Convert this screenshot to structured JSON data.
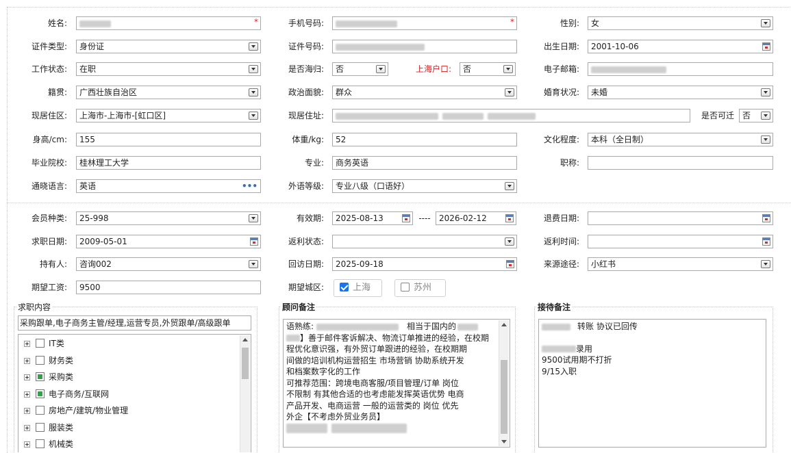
{
  "personal": {
    "name": {
      "label": "姓名:"
    },
    "mobile": {
      "label": "手机号码:"
    },
    "gender": {
      "label": "性别:",
      "value": "女"
    },
    "id_type": {
      "label": "证件类型:",
      "value": "身份证"
    },
    "id_no": {
      "label": "证件号码:"
    },
    "birth": {
      "label": "出生日期:",
      "value": "2001-10-06"
    },
    "work_status": {
      "label": "工作状态:",
      "value": "在职"
    },
    "returnee": {
      "label": "是否海归:",
      "value": "否"
    },
    "hukou": {
      "label": "上海户口:",
      "value": "否"
    },
    "email": {
      "label": "电子邮箱:"
    },
    "native": {
      "label": "籍贯:",
      "value": "广西壮族自治区"
    },
    "political": {
      "label": "政治面貌:",
      "value": "群众"
    },
    "marital": {
      "label": "婚育状况:",
      "value": "未婚"
    },
    "residence_area": {
      "label": "现居住区:",
      "value": "上海市-上海市-[虹口区]"
    },
    "address": {
      "label": "现居住址:"
    },
    "relocate": {
      "label": "是否可迁",
      "value": "否"
    },
    "height": {
      "label": "身高/cm:",
      "value": "155"
    },
    "weight": {
      "label": "体重/kg:",
      "value": "52"
    },
    "education": {
      "label": "文化程度:",
      "value": "本科（全日制）"
    },
    "school": {
      "label": "毕业院校:",
      "value": "桂林理工大学"
    },
    "major": {
      "label": "专业:",
      "value": "商务英语"
    },
    "title": {
      "label": "职称:",
      "value": ""
    },
    "languages": {
      "label": "通晓语言:",
      "value": "英语"
    },
    "lang_level": {
      "label": "外语等级:",
      "value": "专业八级（口语好）"
    }
  },
  "membership": {
    "type": {
      "label": "会员种类:",
      "value": "25-998"
    },
    "validity": {
      "label": "有效期:",
      "from": "2025-08-13",
      "sep": "----",
      "to": "2026-02-12"
    },
    "refund_date": {
      "label": "退费日期:",
      "value": ""
    },
    "job_date": {
      "label": "求职日期:",
      "value": "2009-05-01"
    },
    "rebate_status": {
      "label": "返利状态:",
      "value": ""
    },
    "rebate_time": {
      "label": "返利时间:",
      "value": ""
    },
    "holder": {
      "label": "持有人:",
      "value": "咨询002"
    },
    "visit_date": {
      "label": "回访日期:",
      "value": "2025-09-18"
    },
    "source": {
      "label": "来源途径:",
      "value": "小红书"
    },
    "salary": {
      "label": "期望工资:",
      "value": "9500"
    },
    "city": {
      "label": "期望城区:",
      "options": [
        {
          "label": "上海",
          "checked": true
        },
        {
          "label": "苏州",
          "checked": false
        }
      ]
    }
  },
  "job_content": {
    "title": "求职内容",
    "summary": "采购跟单,电子商务主管/经理,运营专员,外贸跟单/高级跟单",
    "tree": [
      {
        "label": "IT类",
        "state": "unchecked"
      },
      {
        "label": "财务类",
        "state": "unchecked"
      },
      {
        "label": "采购类",
        "state": "partial"
      },
      {
        "label": "电子商务/互联网",
        "state": "partial"
      },
      {
        "label": "房地产/建筑/物业管理",
        "state": "unchecked"
      },
      {
        "label": "服装类",
        "state": "unchecked"
      },
      {
        "label": "机械类",
        "state": "unchecked"
      }
    ]
  },
  "consultant_note": {
    "title": "顾问备注",
    "lines": [
      "语熟练:",
      "相当于国内的",
      "】善于邮件客诉解决、物流订单推进的经验，在校期",
      "程优化意识强，有外贸订单跟进的经验，在校期期",
      "间做的培训机构运营招生 市场营销 协助系统开发",
      "和档案数字化的工作",
      "可推荐范围：跨境电商客服/项目管理/订单 岗位",
      "不限制 有其他合适的也考虑能发挥英语优势 电商",
      "产品开发、电商运营 一般的运营类的 岗位 优先",
      "外企【不考虑外贸业务员】"
    ]
  },
  "reception_note": {
    "title": "接待备注",
    "lines": [
      "转账  协议已回传",
      "",
      "录用",
      "9500试用期不打折",
      "9/15入职"
    ]
  }
}
